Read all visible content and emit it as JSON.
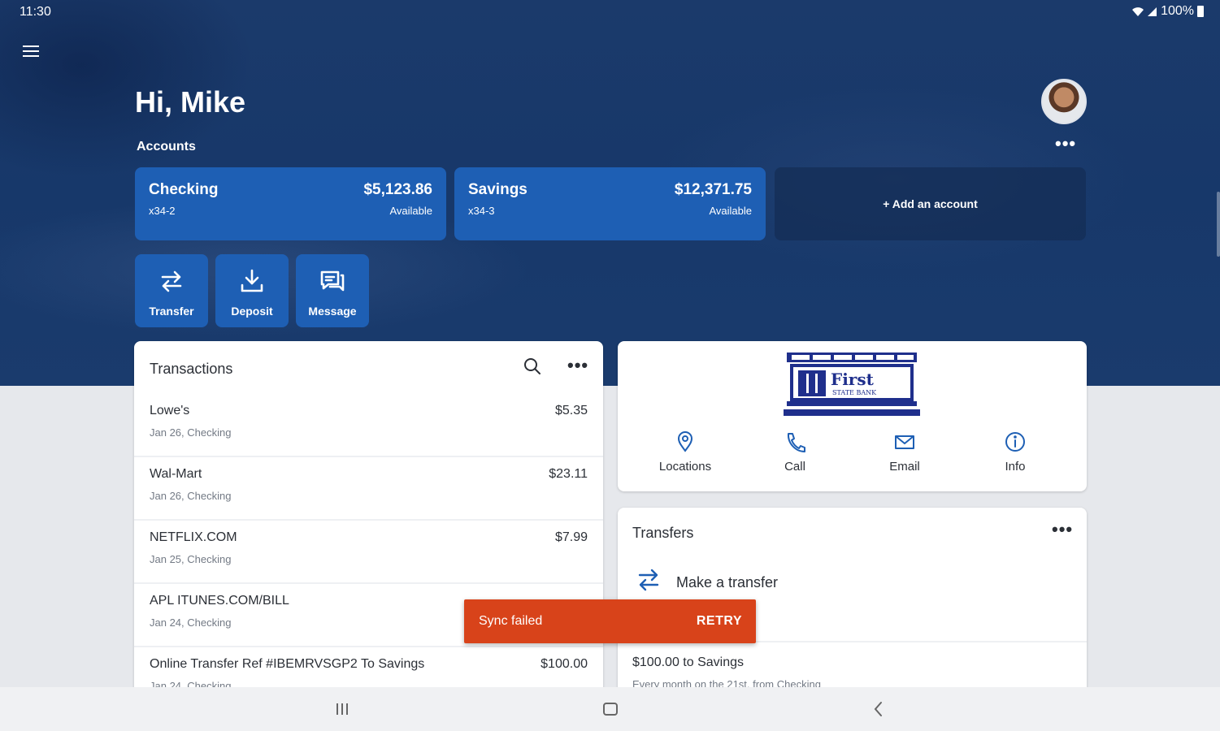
{
  "status_bar": {
    "time": "11:30",
    "battery": "100%"
  },
  "header": {
    "greeting": "Hi, Mike",
    "accounts_label": "Accounts"
  },
  "accounts": [
    {
      "name": "Checking",
      "number": "x34-2",
      "balance": "$5,123.86",
      "balance_label": "Available"
    },
    {
      "name": "Savings",
      "number": "x34-3",
      "balance": "$12,371.75",
      "balance_label": "Available"
    }
  ],
  "add_account_label": "+ Add an account",
  "quick_actions": [
    {
      "label": "Transfer",
      "icon": "transfer-icon"
    },
    {
      "label": "Deposit",
      "icon": "deposit-icon"
    },
    {
      "label": "Message",
      "icon": "message-icon"
    }
  ],
  "transactions": {
    "title": "Transactions",
    "items": [
      {
        "merchant": "Lowe's",
        "detail": "Jan 26, Checking",
        "amount": "$5.35"
      },
      {
        "merchant": "Wal-Mart",
        "detail": "Jan 26, Checking",
        "amount": "$23.11"
      },
      {
        "merchant": "NETFLIX.COM",
        "detail": "Jan 25, Checking",
        "amount": "$7.99"
      },
      {
        "merchant": "APL ITUNES.COM/BILL",
        "detail": "Jan 24, Checking",
        "amount": ""
      },
      {
        "merchant": "Online Transfer Ref #IBEMRVSGP2 To Savings",
        "detail": "Jan 24, Checking",
        "amount": "$100.00"
      }
    ]
  },
  "bank": {
    "logo_text": "First",
    "logo_subtext": "STATE BANK",
    "contacts": [
      {
        "label": "Locations",
        "icon": "location-pin-icon"
      },
      {
        "label": "Call",
        "icon": "phone-icon"
      },
      {
        "label": "Email",
        "icon": "mail-icon"
      },
      {
        "label": "Info",
        "icon": "info-icon"
      }
    ]
  },
  "transfers": {
    "title": "Transfers",
    "make_transfer_label": "Make a transfer",
    "scheduled": "$100.00 to Savings",
    "scheduled_detail": "Every month on the 21st, from Checking"
  },
  "snackbar": {
    "message": "Sync failed",
    "action": "RETRY",
    "color": "#d8431a"
  },
  "colors": {
    "primary": "#1e5fb4",
    "hero": "#1b3a6b",
    "background": "#e6e8ec"
  }
}
